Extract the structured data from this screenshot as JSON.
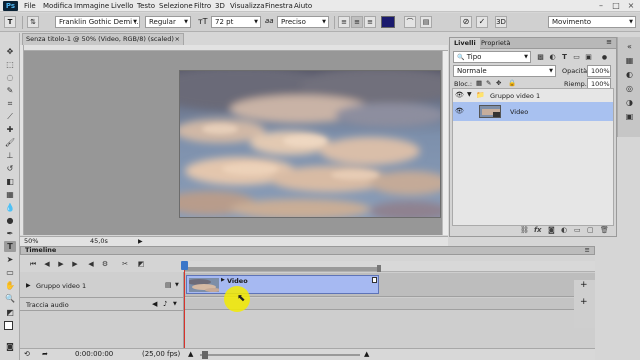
{
  "menu": {
    "logo": "Ps",
    "items": [
      "File",
      "Modifica",
      "Immagine",
      "Livello",
      "Testo",
      "Selezione",
      "Filtro",
      "3D",
      "Visualizza",
      "Finestra",
      "Aiuto"
    ]
  },
  "window_controls": [
    "–",
    "□",
    "×"
  ],
  "options_bar": {
    "font_family": "Franklin Gothic Demi ...",
    "font_style": "Regular",
    "font_size": "72 pt",
    "antialias_symbol": "aa",
    "antialias": "Preciso",
    "text_color": "#1a1a6e",
    "workspace": "Movimento"
  },
  "document": {
    "tab_title": "Senza titolo-1 @ 50% (Video, RGB/8) (scaled)",
    "zoom": "50%",
    "status_time": "45,0s"
  },
  "layers_panel": {
    "tabs": [
      "Livelli",
      "Proprietà"
    ],
    "filter_label": "Tipo",
    "blend_mode": "Normale",
    "opacity_label": "Opacità:",
    "opacity_value": "100%",
    "lock_label": "Bloc.:",
    "fill_label": "Riemp.:",
    "fill_value": "100%",
    "layers": [
      {
        "name": "Gruppo video 1",
        "type": "group"
      },
      {
        "name": "Video",
        "type": "video",
        "selected": true
      }
    ],
    "bottom_icons": [
      "link-icon",
      "fx-icon",
      "mask-icon",
      "adjustment-icon",
      "folder-icon",
      "new-layer-icon",
      "trash-icon"
    ]
  },
  "timeline": {
    "title": "Timeline",
    "tracks": [
      {
        "name": "Gruppo video 1",
        "type": "video"
      },
      {
        "name": "Traccia audio",
        "type": "audio"
      }
    ],
    "clip_name": "Video",
    "timecode": "0:00:00:00",
    "fps": "(25,00 fps)"
  },
  "colors": {
    "clip_fill": "#a6b9f2",
    "selected_layer": "#a8c1f0",
    "playhead": "#d9332b",
    "cursor_highlight": "#f3eb00"
  }
}
